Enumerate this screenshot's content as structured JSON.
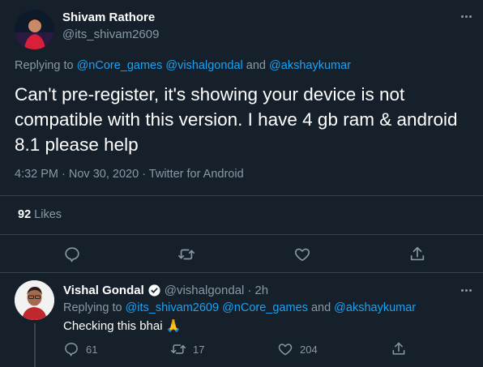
{
  "main_tweet": {
    "author_name": "Shivam Rathore",
    "handle": "@its_shivam2609",
    "replying_prefix": "Replying to",
    "replying_to": [
      "@nCore_games",
      "@vishalgondal",
      "@akshaykumar"
    ],
    "replying_and": "and",
    "text": "Can't pre-register, it's showing your device is not compatible with this version. I have 4 gb ram & android 8.1 please help",
    "time": "4:32 PM",
    "date": "Nov 30, 2020",
    "source": "Twitter for Android",
    "likes_count": "92",
    "likes_label": "Likes"
  },
  "reply_tweet": {
    "author_name": "Vishal Gondal",
    "handle": "@vishalgondal",
    "age": "2h",
    "replying_prefix": "Replying to",
    "replying_to": [
      "@its_shivam2609",
      "@nCore_games",
      "@akshaykumar"
    ],
    "replying_and": "and",
    "text": "Checking this bhai 🙏",
    "replies_count": "61",
    "retweets_count": "17",
    "likes_count": "204"
  },
  "colors": {
    "background": "#15202b",
    "link": "#1da1f2",
    "muted": "#8899a6",
    "divider": "#38444d"
  }
}
